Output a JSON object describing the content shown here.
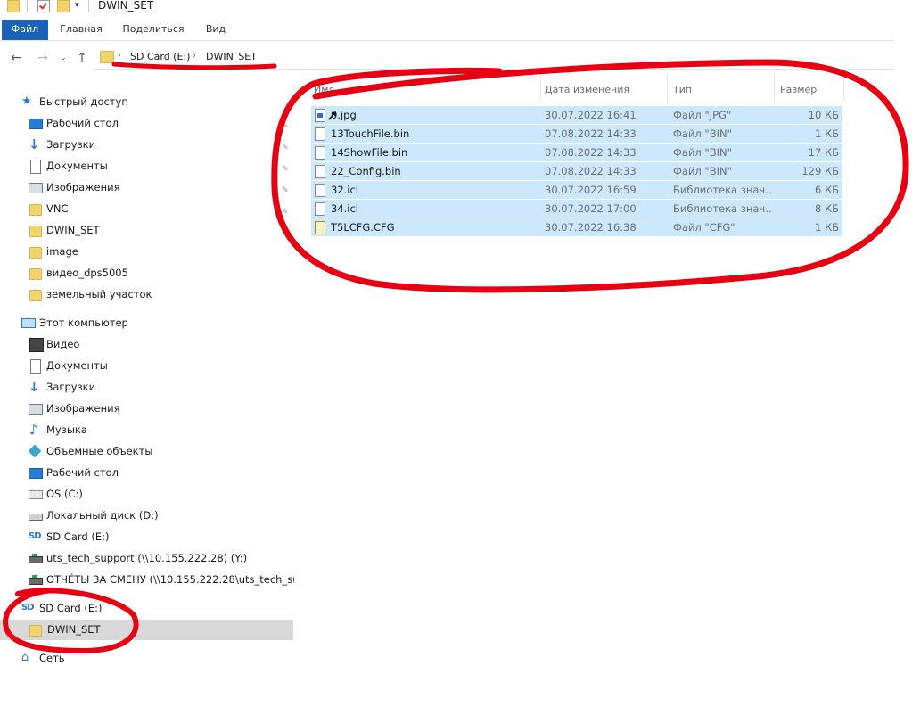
{
  "window": {
    "title": "DWIN_SET"
  },
  "ribbon": {
    "tabs": [
      "Файл",
      "Главная",
      "Поделиться",
      "Вид"
    ]
  },
  "address": {
    "crumbs": [
      "SD Card (E:)",
      "DWIN_SET"
    ]
  },
  "nav": {
    "items": [
      {
        "label": "Быстрый доступ",
        "icon": "star-icon"
      },
      {
        "label": "Рабочий стол",
        "icon": "desktop-icon"
      },
      {
        "label": "Загрузки",
        "icon": "download-icon"
      },
      {
        "label": "Документы",
        "icon": "documents-icon"
      },
      {
        "label": "Изображения",
        "icon": "pictures-icon"
      },
      {
        "label": "VNC",
        "icon": "folder-icon"
      },
      {
        "label": "DWIN_SET",
        "icon": "folder-icon"
      },
      {
        "label": "image",
        "icon": "folder-icon"
      },
      {
        "label": "видео_dps5005",
        "icon": "folder-icon"
      },
      {
        "label": "земельный участок",
        "icon": "folder-icon"
      },
      {
        "label": "Этот компьютер",
        "icon": "computer-icon"
      },
      {
        "label": "Видео",
        "icon": "video-icon"
      },
      {
        "label": "Документы",
        "icon": "documents-icon"
      },
      {
        "label": "Загрузки",
        "icon": "download-icon"
      },
      {
        "label": "Изображения",
        "icon": "pictures-icon"
      },
      {
        "label": "Музыка",
        "icon": "music-icon"
      },
      {
        "label": "Объемные объекты",
        "icon": "3d-objects-icon"
      },
      {
        "label": "Рабочий стол",
        "icon": "desktop-icon"
      },
      {
        "label": "OS (C:)",
        "icon": "os-drive-icon"
      },
      {
        "label": "Локальный диск (D:)",
        "icon": "drive-icon"
      },
      {
        "label": "SD Card (E:)",
        "icon": "sd-card-icon"
      },
      {
        "label": "uts_tech_support (\\\\10.155.222.28) (Y:)",
        "icon": "network-drive-icon"
      },
      {
        "label": "ОТЧЁТЫ ЗА СМЕНУ (\\\\10.155.222.28\\uts_tech_suppo",
        "icon": "network-drive-icon"
      },
      {
        "label": "SD Card (E:)",
        "icon": "sd-card-icon"
      },
      {
        "label": "DWIN_SET",
        "icon": "folder-icon"
      },
      {
        "label": "Сеть",
        "icon": "network-icon"
      }
    ]
  },
  "columns": {
    "name": "Имя",
    "date": "Дата изменения",
    "type": "Тип",
    "size": "Размер"
  },
  "files": [
    {
      "name": "0.jpg",
      "date": "30.07.2022 16:41",
      "type": "Файл \"JPG\"",
      "size": "10 КБ",
      "icon": "jpg-file-icon"
    },
    {
      "name": "13TouchFile.bin",
      "date": "07.08.2022 14:33",
      "type": "Файл \"BIN\"",
      "size": "1 КБ",
      "icon": "file-icon"
    },
    {
      "name": "14ShowFile.bin",
      "date": "07.08.2022 14:33",
      "type": "Файл \"BIN\"",
      "size": "17 КБ",
      "icon": "file-icon"
    },
    {
      "name": "22_Config.bin",
      "date": "07.08.2022 14:33",
      "type": "Файл \"BIN\"",
      "size": "129 КБ",
      "icon": "file-icon"
    },
    {
      "name": "32.icl",
      "date": "30.07.2022 16:59",
      "type": "Библиотека знач...",
      "size": "6 КБ",
      "icon": "file-icon"
    },
    {
      "name": "34.icl",
      "date": "30.07.2022 17:00",
      "type": "Библиотека знач...",
      "size": "8 КБ",
      "icon": "file-icon"
    },
    {
      "name": "T5LCFG.CFG",
      "date": "30.07.2022 16:38",
      "type": "Файл \"CFG\"",
      "size": "1 КБ",
      "icon": "cfg-file-icon"
    }
  ],
  "colors": {
    "accent": "#1a62b8",
    "selection": "#cce8ff",
    "annotation": "#e60012"
  }
}
